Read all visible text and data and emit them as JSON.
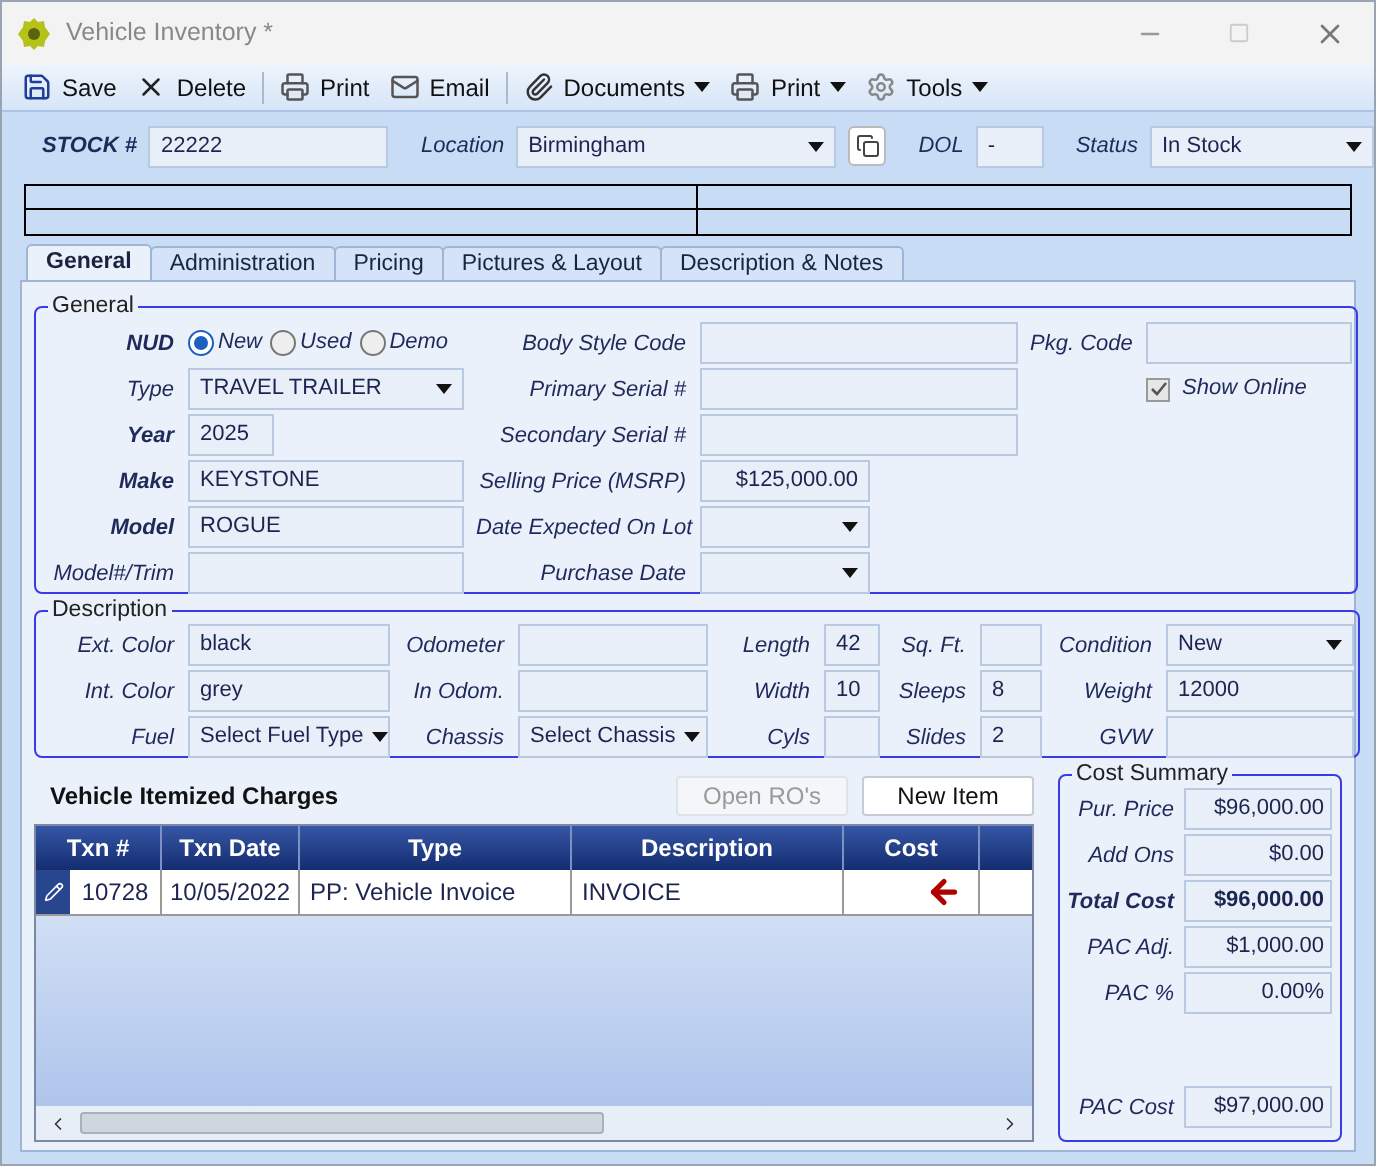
{
  "window": {
    "title": "Vehicle Inventory *"
  },
  "toolbar": {
    "groups": [
      {
        "items": [
          {
            "label": "Save",
            "kind": "button"
          },
          {
            "label": "Delete",
            "kind": "button"
          }
        ]
      },
      {
        "items": [
          {
            "label": "Print",
            "kind": "button"
          },
          {
            "label": "Email",
            "kind": "button"
          }
        ]
      },
      {
        "items": [
          {
            "label": "Documents",
            "kind": "dropdown"
          },
          {
            "label": "Print",
            "kind": "dropdown"
          },
          {
            "label": "Tools",
            "kind": "dropdown"
          }
        ]
      }
    ]
  },
  "header": {
    "fields": [
      {
        "label": "STOCK #",
        "value": "22222",
        "kind": "text",
        "bold": true
      },
      {
        "label": "Location",
        "value": "Birmingham",
        "kind": "select",
        "bold": false
      },
      {
        "label": "DOL",
        "value": "-",
        "kind": "text",
        "bold": false
      },
      {
        "label": "Status",
        "value": "In Stock",
        "kind": "select",
        "bold": false
      }
    ]
  },
  "tabs": [
    {
      "label": "General",
      "selected": true
    },
    {
      "label": "Administration",
      "selected": false
    },
    {
      "label": "Pricing",
      "selected": false
    },
    {
      "label": "Pictures & Layout",
      "selected": false
    },
    {
      "label": "Description & Notes",
      "selected": false
    }
  ],
  "general": {
    "title": "General",
    "columns": [
      [
        {
          "label": "NUD",
          "kind": "radio",
          "bold": true,
          "options": [
            {
              "label": "New",
              "selected": true
            },
            {
              "label": "Used",
              "selected": false
            },
            {
              "label": "Demo",
              "selected": false
            }
          ]
        },
        {
          "label": "Type",
          "kind": "select",
          "value": "TRAVEL TRAILER",
          "bold": false
        },
        {
          "label": "Year",
          "kind": "text",
          "value": "2025",
          "bold": true
        },
        {
          "label": "Make",
          "kind": "text",
          "value": "KEYSTONE",
          "bold": true
        },
        {
          "label": "Model",
          "kind": "text",
          "value": "ROGUE",
          "bold": true
        },
        {
          "label": "Model#/Trim",
          "kind": "text",
          "bold": false
        }
      ],
      [
        {
          "label": "Body Style Code",
          "kind": "text",
          "bold": false
        },
        {
          "label": "Primary Serial #",
          "kind": "text",
          "bold": false
        },
        {
          "label": "Secondary Serial #",
          "kind": "text",
          "bold": false
        },
        {
          "label": "Selling Price (MSRP)",
          "kind": "money",
          "value": "$125,000.00",
          "bold": false
        },
        {
          "label": "Date Expected On Lot",
          "kind": "select",
          "bold": false
        },
        {
          "label": "Purchase Date",
          "kind": "select",
          "bold": false
        }
      ],
      [
        {
          "label": "Pkg. Code",
          "kind": "text",
          "bold": false
        },
        {
          "label": "Show Online",
          "kind": "checkbox",
          "checked": true,
          "bold": false
        }
      ]
    ]
  },
  "description": {
    "title": "Description",
    "columns": [
      [
        {
          "label": "Ext. Color",
          "kind": "text",
          "value": "black"
        },
        {
          "label": "Int. Color",
          "kind": "text",
          "value": "grey"
        },
        {
          "label": "Fuel",
          "kind": "select",
          "value": "Select Fuel Type"
        }
      ],
      [
        {
          "label": "Odometer",
          "kind": "text"
        },
        {
          "label": "In Odom.",
          "kind": "text"
        },
        {
          "label": "Chassis",
          "kind": "select",
          "value": "Select Chassis"
        }
      ],
      [
        {
          "label": "Length",
          "kind": "text",
          "value": "42"
        },
        {
          "label": "Width",
          "kind": "text",
          "value": "10"
        },
        {
          "label": "Cyls",
          "kind": "text"
        }
      ],
      [
        {
          "label": "Sq. Ft.",
          "kind": "text"
        },
        {
          "label": "Sleeps",
          "kind": "text",
          "value": "8"
        },
        {
          "label": "Slides",
          "kind": "text",
          "value": "2"
        }
      ],
      [
        {
          "label": "Condition",
          "kind": "select",
          "value": "New"
        },
        {
          "label": "Weight",
          "kind": "text",
          "value": "12000"
        },
        {
          "label": "GVW",
          "kind": "text"
        }
      ]
    ]
  },
  "charges": {
    "title": "Vehicle Itemized Charges",
    "buttons": [
      {
        "label": "Open RO's",
        "disabled": true
      },
      {
        "label": "New Item",
        "disabled": false
      }
    ],
    "columns": [
      "Txn #",
      "Txn Date",
      "Type",
      "Description",
      "Cost"
    ],
    "rows": [
      {
        "cells": [
          "10728",
          "10/05/2022",
          "PP: Vehicle Invoice",
          "INVOICE"
        ]
      }
    ]
  },
  "cost_summary": {
    "title": "Cost Summary",
    "rows": [
      {
        "label": "Pur. Price",
        "value": "$96,000.00",
        "bold": false
      },
      {
        "label": "Add Ons",
        "value": "$0.00",
        "bold": false
      },
      {
        "label": "Total Cost",
        "value": "$96,000.00",
        "bold": true
      },
      {
        "label": "PAC Adj.",
        "value": "$1,000.00",
        "bold": false
      },
      {
        "label": "PAC %",
        "value": "0.00%",
        "bold": false
      },
      {
        "label": "PAC Cost",
        "value": "$97,000.00",
        "bold": false
      }
    ]
  }
}
